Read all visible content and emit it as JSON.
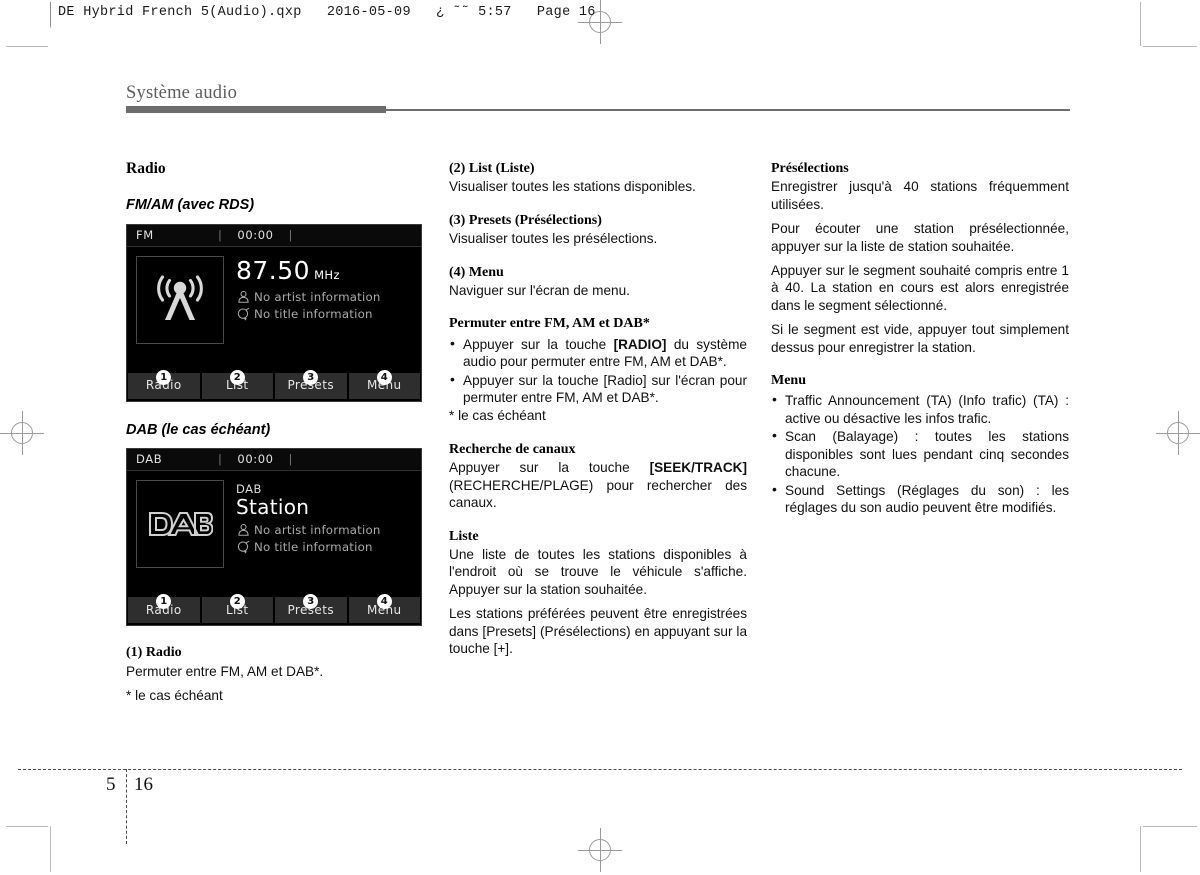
{
  "film_header": "DE Hybrid French 5(Audio).qxp   2016-05-09   ¿ ˜˜ 5:57   Page 16",
  "running_head": "Système audio",
  "footer": {
    "chapter": "5",
    "page": "16"
  },
  "left_column": {
    "section_title": "Radio",
    "fm_heading": "FM/AM (avec RDS)",
    "dab_heading": "DAB (le cas échéant)",
    "fm_screen": {
      "status_mode": "FM",
      "status_time": "00:00",
      "separator": "|",
      "artwork_icon": "broadcast-tower-icon",
      "frequency": "87.50",
      "frequency_unit": "MHz",
      "artist_icon": "person-icon",
      "artist_text": "No artist information",
      "title_icon": "music-note-icon",
      "title_text": "No title information",
      "buttons": [
        {
          "number": "1",
          "label": "Radio"
        },
        {
          "number": "2",
          "label": "List"
        },
        {
          "number": "3",
          "label": "Presets"
        },
        {
          "number": "4",
          "label": "Menu"
        }
      ]
    },
    "dab_screen": {
      "status_mode": "DAB",
      "status_time": "00:00",
      "separator": "|",
      "artwork_icon": "dab-logo-icon",
      "artwork_text": "DAB",
      "label_small": "DAB",
      "station_name": "Station",
      "artist_icon": "person-icon",
      "artist_text": "No artist information",
      "title_icon": "music-note-icon",
      "title_text": "No title information",
      "buttons": [
        {
          "number": "1",
          "label": "Radio"
        },
        {
          "number": "2",
          "label": "List"
        },
        {
          "number": "3",
          "label": "Presets"
        },
        {
          "number": "4",
          "label": "Menu"
        }
      ]
    },
    "item1_heading": "(1) Radio",
    "item1_body": "Permuter entre FM, AM et DAB*.",
    "item1_footnote": "* le cas échéant"
  },
  "middle_column": {
    "item2_heading": "(2) List (Liste)",
    "item2_body": "Visualiser toutes les stations disponibles.",
    "item3_heading": "(3) Presets (Présélections)",
    "item3_body": "Visualiser toutes les présélections.",
    "item4_heading": "(4) Menu",
    "item4_body": "Naviguer sur l'écran de menu.",
    "switch_heading": "Permuter entre FM, AM et DAB*",
    "switch_bullet_1_pre": "Appuyer sur la touche ",
    "switch_bullet_1_bold": "[RADIO]",
    "switch_bullet_1_post": " du système audio pour permuter entre FM, AM et DAB*.",
    "switch_bullet_2": "Appuyer sur la touche [Radio] sur l'écran pour permuter entre FM, AM et DAB*.",
    "switch_footnote": "* le cas échéant",
    "seek_heading": "Recherche de canaux",
    "seek_body_pre": "Appuyer sur la touche ",
    "seek_body_bold": "[SEEK/TRACK]",
    "seek_body_post": " (RECHERCHE/PLAGE) pour rechercher des canaux.",
    "list_heading": "Liste",
    "list_body_1": "Une liste de toutes les stations disponibles à l'endroit où se trouve le véhicule s'affiche. Appuyer sur la station souhaitée.",
    "list_body_2": "Les stations préférées peuvent être enregistrées dans [Presets] (Présélections) en appuyant sur la touche [+]."
  },
  "right_column": {
    "presets_heading": "Présélections",
    "presets_body_1": "Enregistrer jusqu'à 40 stations fréquemment utilisées.",
    "presets_body_2": "Pour écouter une station présélectionnée, appuyer sur la liste de station souhaitée.",
    "presets_body_3": "Appuyer sur le segment souhaité compris entre 1 à 40. La station en cours est alors enregistrée dans le segment sélectionné.",
    "presets_body_4": "Si le segment est vide, appuyer tout simplement dessus pour enregistrer la station.",
    "menu_heading": "Menu",
    "menu_bullet_1": "Traffic Announcement (TA) (Info trafic) (TA) : active ou désactive les infos trafic.",
    "menu_bullet_2": "Scan (Balayage) : toutes les stations disponibles sont lues pendant cinq secondes chacune.",
    "menu_bullet_3": "Sound Settings (Réglages du son) : les réglages du son audio peuvent être modifiés."
  },
  "colors": {
    "screen_background": "#000000",
    "screen_button": "#2e2e2e",
    "head_rule": "#6d6d6d",
    "running_head_text": "#5d5d5d"
  }
}
